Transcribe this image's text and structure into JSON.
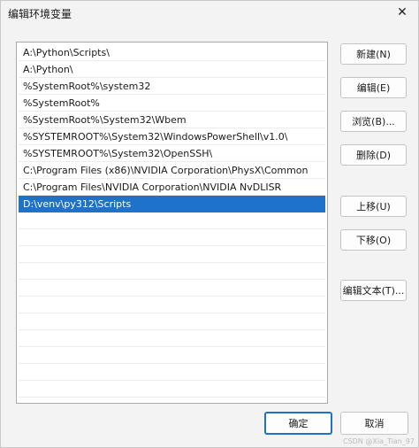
{
  "window": {
    "title": "编辑环境变量",
    "close_glyph": "✕"
  },
  "list": {
    "items": [
      "A:\\Python\\Scripts\\",
      "A:\\Python\\",
      "%SystemRoot%\\system32",
      "%SystemRoot%",
      "%SystemRoot%\\System32\\Wbem",
      "%SYSTEMROOT%\\System32\\WindowsPowerShell\\v1.0\\",
      "%SYSTEMROOT%\\System32\\OpenSSH\\",
      "C:\\Program Files (x86)\\NVIDIA Corporation\\PhysX\\Common",
      "C:\\Program Files\\NVIDIA Corporation\\NVIDIA NvDLISR",
      "D:\\venv\\py312\\Scripts"
    ],
    "selected_index": 9
  },
  "buttons": {
    "new": "新建(N)",
    "edit": "编辑(E)",
    "browse": "浏览(B)...",
    "delete": "删除(D)",
    "move_up": "上移(U)",
    "move_down": "下移(O)",
    "edit_text": "编辑文本(T)...",
    "ok": "确定",
    "cancel": "取消"
  },
  "watermark": "CSDN @Xia_Tian_97",
  "colors": {
    "selection": "#1e72c9",
    "primary_border": "#1e72c9"
  }
}
